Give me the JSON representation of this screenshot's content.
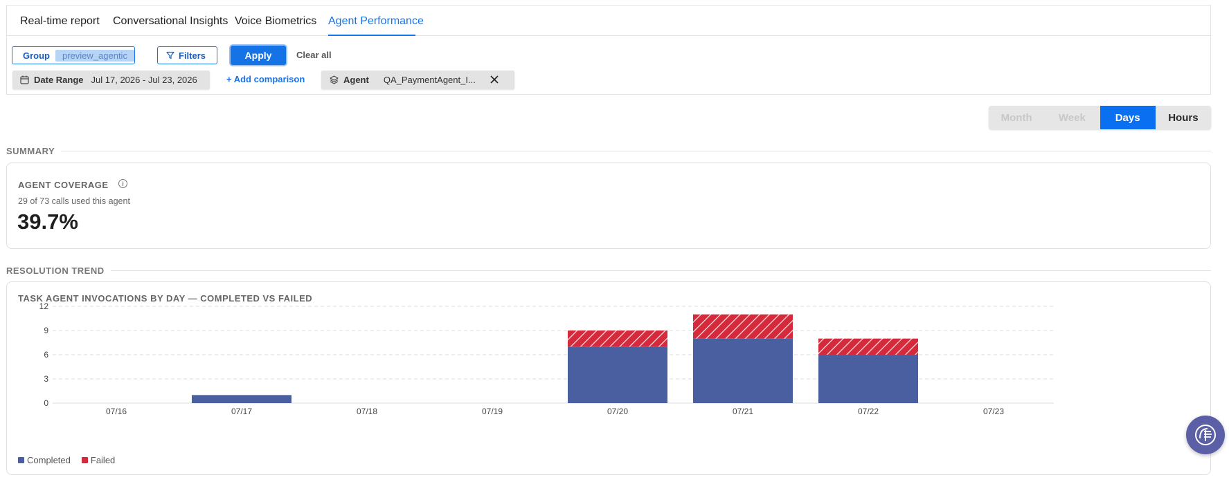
{
  "tabs": [
    {
      "label": "Real-time report"
    },
    {
      "label": "Conversational Insights"
    },
    {
      "label": "Voice Biometrics"
    },
    {
      "label": "Agent Performance",
      "active": true
    }
  ],
  "filters": {
    "group_label": "Group",
    "group_value": "preview_agentic",
    "filters_label": "Filters",
    "apply_label": "Apply",
    "clear_all_label": "Clear all",
    "date_range_label": "Date Range",
    "date_range_value": "Jul 17, 2026 - Jul 23, 2026",
    "add_comparison_label": "+ Add comparison",
    "agent_label": "Agent",
    "agent_value": "QA_PaymentAgent_I..."
  },
  "granularity": {
    "options": [
      "Month",
      "Week",
      "Days",
      "Hours"
    ],
    "selected": "Days"
  },
  "summary": {
    "section_title": "SUMMARY",
    "coverage_title": "AGENT COVERAGE",
    "coverage_subtitle": "29 of 73 calls used this agent",
    "coverage_value": "39.7%"
  },
  "resolution": {
    "section_title": "RESOLUTION TREND",
    "chart_title": "TASK AGENT INVOCATIONS BY DAY — COMPLETED VS FAILED"
  },
  "colors": {
    "accent": "#1a73e8",
    "completed": "#4a5fa0",
    "failed": "#d42a3c"
  },
  "chart_data": {
    "type": "bar",
    "stacked": true,
    "categories": [
      "07/16",
      "07/17",
      "07/18",
      "07/19",
      "07/20",
      "07/21",
      "07/22",
      "07/23"
    ],
    "series": [
      {
        "name": "Completed",
        "values": [
          0,
          1,
          0,
          0,
          7,
          8,
          6,
          0
        ]
      },
      {
        "name": "Failed",
        "values": [
          0,
          0,
          0,
          0,
          2,
          3,
          2,
          0
        ]
      }
    ],
    "yticks": [
      0,
      3,
      6,
      9,
      12
    ],
    "ylim": [
      0,
      12
    ],
    "grid": true,
    "legend_position": "bottom-left"
  }
}
